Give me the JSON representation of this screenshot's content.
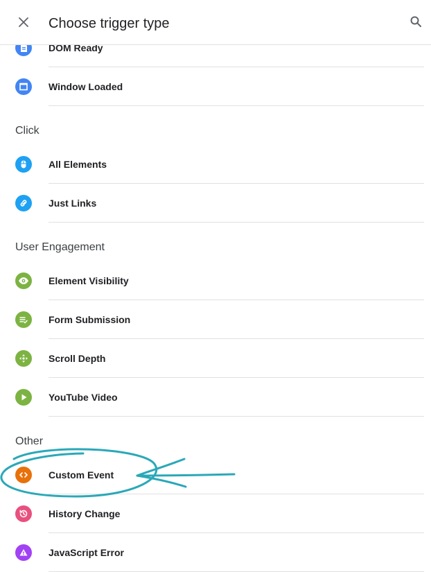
{
  "header": {
    "title": "Choose trigger type"
  },
  "sections": [
    {
      "label": "Click"
    },
    {
      "label": "User Engagement"
    },
    {
      "label": "Other"
    }
  ],
  "items": [
    {
      "label": "DOM Ready",
      "icon": "document-icon",
      "color": "#4285f4"
    },
    {
      "label": "Window Loaded",
      "icon": "window-icon",
      "color": "#4285f4"
    },
    {
      "label": "All Elements",
      "icon": "mouse-icon",
      "color": "#1ea1f2"
    },
    {
      "label": "Just Links",
      "icon": "link-icon",
      "color": "#1ea1f2"
    },
    {
      "label": "Element Visibility",
      "icon": "eye-icon",
      "color": "#7cb342"
    },
    {
      "label": "Form Submission",
      "icon": "form-check-icon",
      "color": "#7cb342"
    },
    {
      "label": "Scroll Depth",
      "icon": "scroll-arrows-icon",
      "color": "#7cb342"
    },
    {
      "label": "YouTube Video",
      "icon": "play-icon",
      "color": "#7cb342"
    },
    {
      "label": "Custom Event",
      "icon": "code-icon",
      "color": "#e8710a"
    },
    {
      "label": "History Change",
      "icon": "history-icon",
      "color": "#e8507f"
    },
    {
      "label": "JavaScript Error",
      "icon": "warning-icon",
      "color": "#a142f4"
    }
  ],
  "annotation": {
    "color": "#2aa8b8"
  }
}
